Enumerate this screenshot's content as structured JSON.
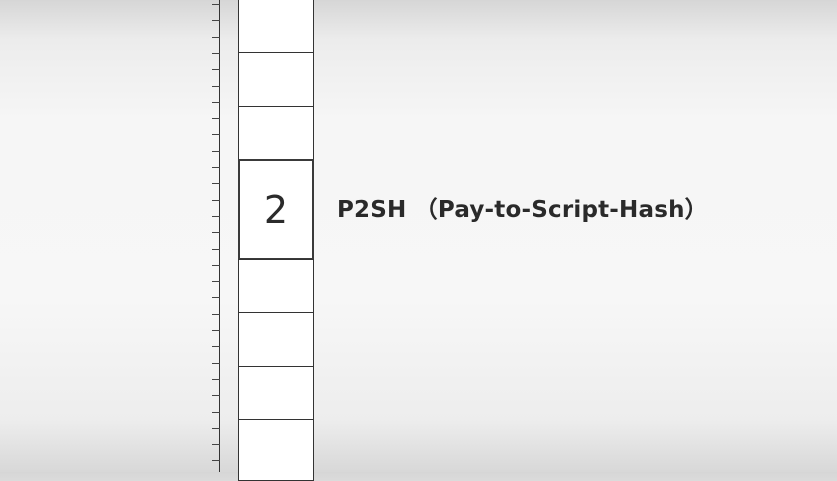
{
  "selected_cell": {
    "value": "2"
  },
  "label": {
    "text": "P2SH （Pay-to-Script-Hash）"
  }
}
